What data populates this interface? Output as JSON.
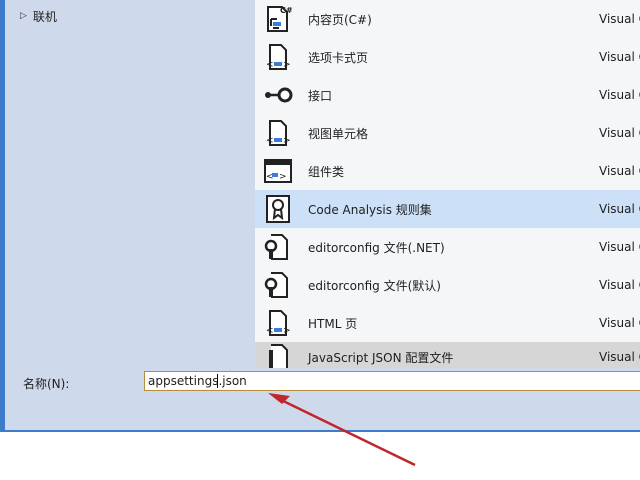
{
  "sidebar": {
    "items": [
      {
        "label": "联机"
      }
    ]
  },
  "templates": [
    {
      "name": "内容页(C#)",
      "lang": "Visual C",
      "icon": "content-page-csharp-icon"
    },
    {
      "name": "选项卡式页",
      "lang": "Visual C",
      "icon": "tabbed-page-icon"
    },
    {
      "name": "接口",
      "lang": "Visual C",
      "icon": "interface-icon"
    },
    {
      "name": "视图单元格",
      "lang": "Visual C",
      "icon": "view-cell-icon"
    },
    {
      "name": "组件类",
      "lang": "Visual C",
      "icon": "component-class-icon"
    },
    {
      "name": "Code Analysis 规则集",
      "lang": "Visual C",
      "icon": "ruleset-icon"
    },
    {
      "name": "editorconfig 文件(.NET)",
      "lang": "Visual C",
      "icon": "editorconfig-icon"
    },
    {
      "name": "editorconfig 文件(默认)",
      "lang": "Visual C",
      "icon": "editorconfig-icon"
    },
    {
      "name": "HTML 页",
      "lang": "Visual C",
      "icon": "html-page-icon"
    },
    {
      "name": "JavaScript JSON 配置文件",
      "lang": "Visual C",
      "icon": "json-config-icon"
    }
  ],
  "name_field": {
    "label": "名称(N):",
    "value": "appsettings.json"
  },
  "colors": {
    "selection": "#cce0f8",
    "panel": "#cfd9ec",
    "border": "#3c7cc8",
    "arrow": "#c0262a"
  }
}
